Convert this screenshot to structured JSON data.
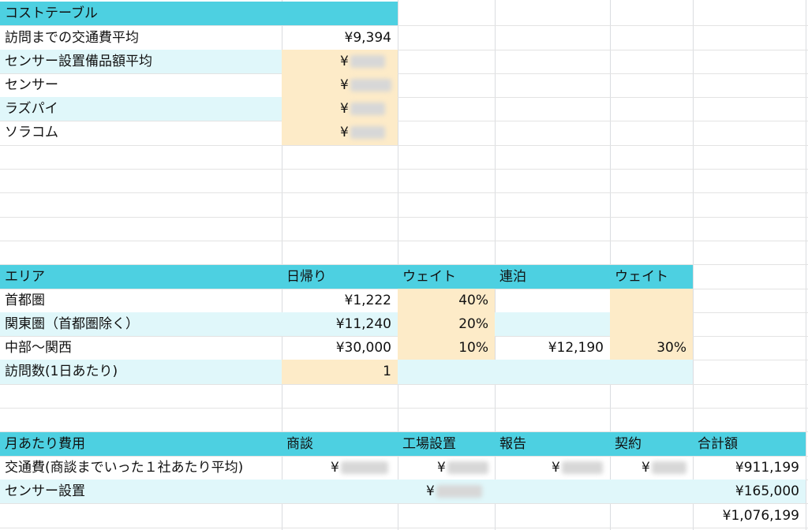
{
  "cost_table": {
    "title": "コストテーブル",
    "rows": [
      {
        "label": "訪問までの交通費平均",
        "value": "¥9,394"
      },
      {
        "label": "センサー設置備品額平均",
        "value": "¥"
      },
      {
        "label": "センサー",
        "value": "¥"
      },
      {
        "label": "ラズパイ",
        "value": "¥"
      },
      {
        "label": "ソラコム",
        "value": "¥"
      }
    ]
  },
  "area_table": {
    "headers": [
      "エリア",
      "日帰り",
      "ウェイト",
      "連泊",
      "ウェイト"
    ],
    "rows": [
      {
        "area": "首都圏",
        "day": "¥1,222",
        "w1": "40%",
        "stay": "",
        "w2": ""
      },
      {
        "area": "関東圏（首都圏除く）",
        "day": "¥11,240",
        "w1": "20%",
        "stay": "",
        "w2": ""
      },
      {
        "area": "中部〜関西",
        "day": "¥30,000",
        "w1": "10%",
        "stay": "¥12,190",
        "w2": "30%"
      }
    ],
    "visits_label": "訪問数(1日あたり)",
    "visits_value": "1"
  },
  "monthly_table": {
    "headers": [
      "月あたり費用",
      "商談",
      "工場設置",
      "報告",
      "契約",
      "合計額"
    ],
    "rows": [
      {
        "label": "交通費(商談までいった１社あたり平均)",
        "c1": "¥",
        "c2": "¥",
        "c3": "¥",
        "c4": "¥",
        "total": "¥911,199"
      },
      {
        "label": "センサー設置",
        "c1": "",
        "c2": "¥",
        "c3": "",
        "c4": "",
        "total": "¥165,000"
      }
    ],
    "grand_total": "¥1,076,199"
  },
  "colors": {
    "header": "#4dd0e1",
    "light": "#e0f7fa",
    "input": "#fdebc8"
  }
}
